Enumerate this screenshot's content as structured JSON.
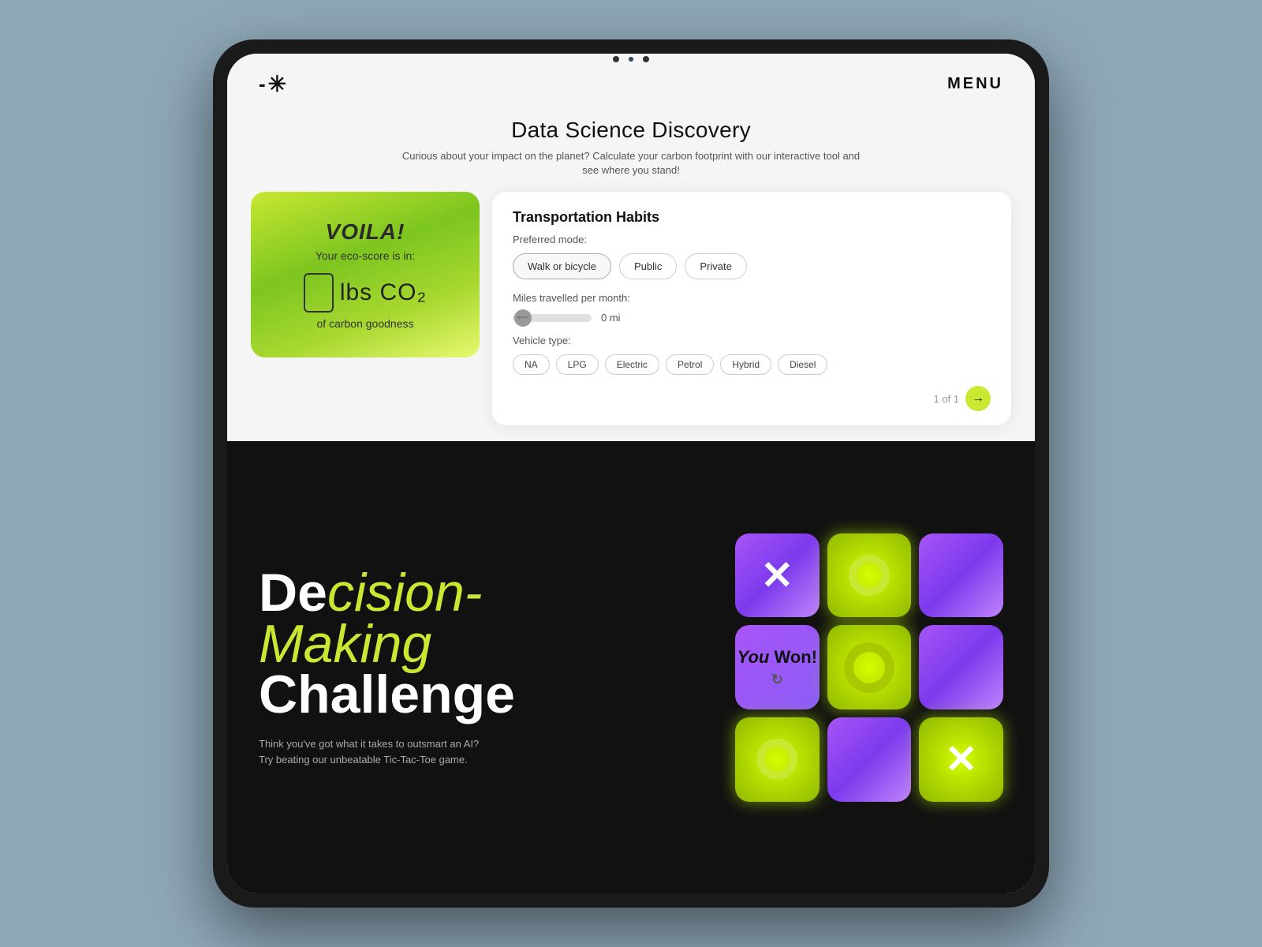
{
  "nav": {
    "logo_dash": "-",
    "logo_asterisk": "✳",
    "menu_label": "MENU"
  },
  "page": {
    "title": "Data Science Discovery",
    "subtitle": "Curious about your impact on the planet? Calculate your carbon footprint with our interactive tool and see where you stand!"
  },
  "eco_card": {
    "voila": "VOILA!",
    "your_score": "Your eco-score is in:",
    "unit": "lbs CO₂",
    "goodness": "of carbon goodness"
  },
  "transport": {
    "card_title": "Transportation Habits",
    "preferred_mode_label": "Preferred mode:",
    "mode_buttons": [
      {
        "label": "Walk or bicycle",
        "active": true
      },
      {
        "label": "Public",
        "active": false
      },
      {
        "label": "Private",
        "active": false
      }
    ],
    "miles_label": "Miles travelled per month:",
    "miles_value": "0 mi",
    "vehicle_label": "Vehicle type:",
    "vehicle_buttons": [
      {
        "label": "NA"
      },
      {
        "label": "LPG"
      },
      {
        "label": "Electric"
      },
      {
        "label": "Petrol"
      },
      {
        "label": "Hybrid"
      },
      {
        "label": "Diesel"
      }
    ],
    "footer_text": "1 of 1",
    "next_arrow": "→"
  },
  "decision": {
    "title_line1_de": "De",
    "title_line1_cision": "cision-",
    "title_line2": "Making",
    "title_line3": "Challenge",
    "subtitle": "Think you've got what it takes to outsmart an AI?\nTry beating our unbeatable Tic-Tac-Toe game."
  },
  "ttt": {
    "cells": [
      {
        "type": "x",
        "color": "purple"
      },
      {
        "type": "o",
        "color": "lime"
      },
      {
        "type": "empty",
        "color": "purple"
      },
      {
        "type": "win",
        "color": "win"
      },
      {
        "type": "o-large",
        "color": "lime"
      },
      {
        "type": "empty",
        "color": "purple"
      },
      {
        "type": "o",
        "color": "lime"
      },
      {
        "type": "empty",
        "color": "purple"
      },
      {
        "type": "x",
        "color": "lime"
      }
    ],
    "win_you": "You",
    "win_won": "Won!",
    "win_refresh": "↻"
  }
}
